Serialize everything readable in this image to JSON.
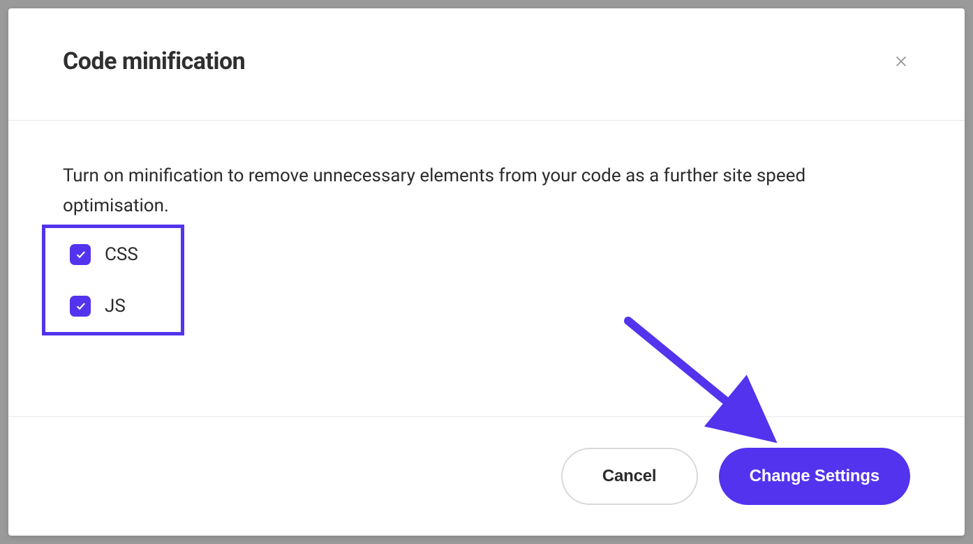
{
  "modal": {
    "title": "Code minification",
    "description": "Turn on minification to remove unnecessary elements from your code as a further site speed optimisation.",
    "checkboxes": [
      {
        "label": "CSS",
        "checked": true
      },
      {
        "label": "JS",
        "checked": true
      }
    ],
    "buttons": {
      "cancel": "Cancel",
      "primary": "Change Settings"
    }
  },
  "colors": {
    "accent": "#5333ed"
  }
}
